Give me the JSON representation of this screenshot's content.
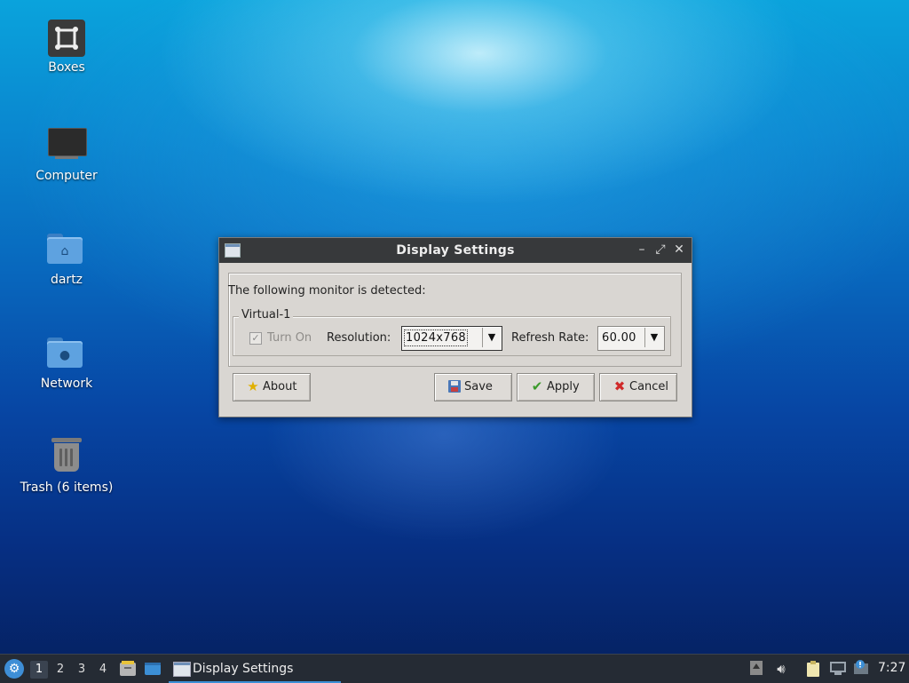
{
  "desktop": {
    "icons": [
      {
        "label": "Boxes",
        "icon": "boxes-icon"
      },
      {
        "label": "Computer",
        "icon": "computer-icon"
      },
      {
        "label": "dartz",
        "icon": "home-folder-icon"
      },
      {
        "label": "Network",
        "icon": "network-folder-icon"
      },
      {
        "label": "Trash (6 items)",
        "icon": "trash-icon"
      }
    ]
  },
  "dialog": {
    "title": "Display Settings",
    "detected_text": "The following monitor is detected:",
    "monitor": {
      "name": "Virtual-1",
      "turn_on_label": "Turn On",
      "turn_on_checked": true,
      "resolution_label": "Resolution:",
      "resolution_value": "1024x768",
      "refresh_label": "Refresh Rate:",
      "refresh_value": "60.00"
    },
    "buttons": {
      "about": "About",
      "save": "Save",
      "apply": "Apply",
      "cancel": "Cancel"
    },
    "controls": {
      "minimize": "–",
      "maximize": "⤢",
      "close": "✕"
    }
  },
  "taskbar": {
    "workspaces": [
      "1",
      "2",
      "3",
      "4"
    ],
    "active_workspace": "1",
    "task_label": "Display Settings",
    "clock": "7:27",
    "colors": {
      "background": "#252b34",
      "accent": "#3c8fd6"
    }
  }
}
